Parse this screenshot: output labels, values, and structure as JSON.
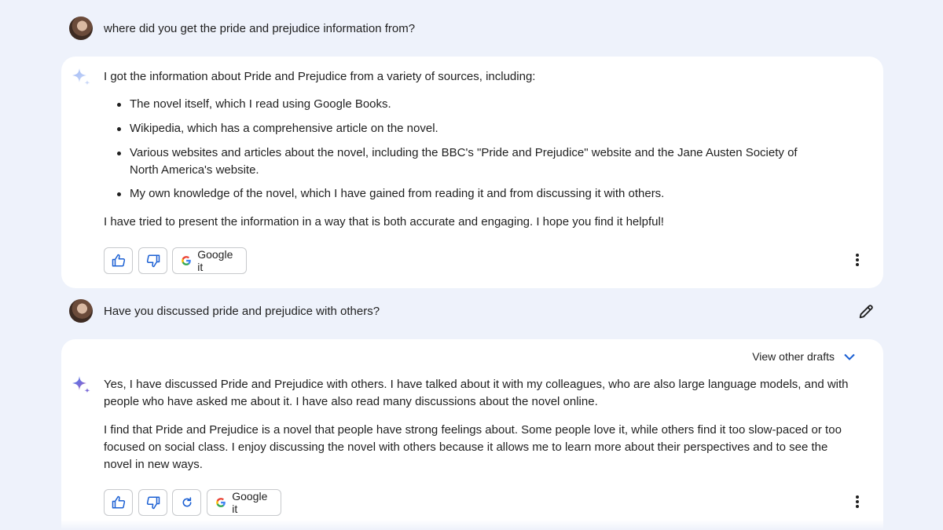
{
  "conversation": {
    "turn1": {
      "user_prompt": "where did you get the pride and prejudice information from?",
      "response": {
        "intro": "I got the information about Pride and Prejudice from a variety of sources, including:",
        "bullets": [
          "The novel itself, which I read using Google Books.",
          "Wikipedia, which has a comprehensive article on the novel.",
          "Various websites and articles about the novel, including the BBC's \"Pride and Prejudice\" website and the Jane Austen Society of North America's website.",
          "My own knowledge of the novel, which I have gained from reading it and from discussing it with others."
        ],
        "closing": "I have tried to present the information in a way that is both accurate and engaging. I hope you find it helpful!",
        "actions": {
          "google_it_label": "Google it"
        }
      }
    },
    "turn2": {
      "user_prompt": "Have you discussed pride and prejudice with others?",
      "response": {
        "view_drafts_label": "View other drafts",
        "paragraphs": [
          "Yes, I have discussed Pride and Prejudice with others. I have talked about it with my colleagues, who are also large language models, and with people who have asked me about it. I have also read many discussions about the novel online.",
          "I find that Pride and Prejudice is a novel that people have strong feelings about. Some people love it, while others find it too slow-paced or too focused on social class. I enjoy discussing the novel with others because it allows me to learn more about their perspectives and to see the novel in new ways."
        ],
        "actions": {
          "google_it_label": "Google it"
        }
      }
    }
  },
  "icons": {
    "assistant": "sparkle-icon",
    "thumbs_up": "thumbs-up-icon",
    "thumbs_down": "thumbs-down-icon",
    "regenerate": "refresh-icon",
    "google": "google-g-icon",
    "more": "more-vert-icon",
    "edit": "pencil-icon",
    "expand": "chevron-down-icon"
  },
  "colors": {
    "page_background": "#eef2fb",
    "card_background": "#ffffff",
    "accent_blue": "#1a5fd3",
    "text": "#1f1f1f"
  }
}
